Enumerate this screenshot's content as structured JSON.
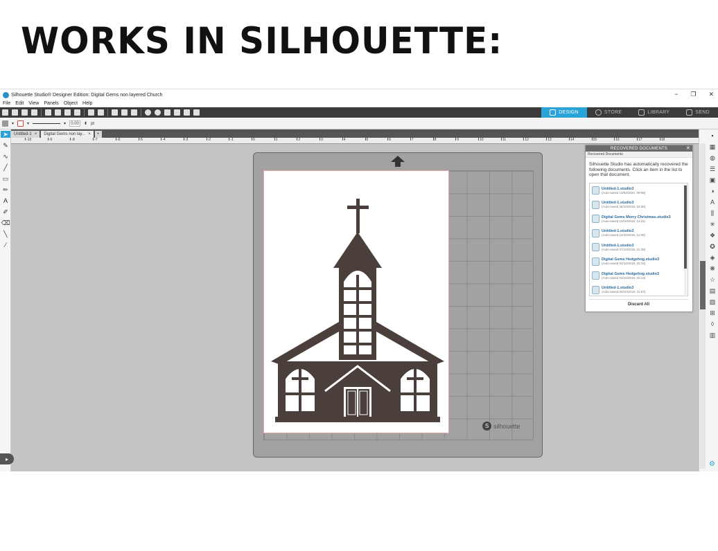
{
  "headline": "WORKS IN SILHOUETTE:",
  "window": {
    "title": "Silhouette Studio® Designer Edition: Digital Gems non layered Church",
    "controls": [
      "−",
      "❐",
      "✕"
    ]
  },
  "menu": [
    "File",
    "Edit",
    "View",
    "Panels",
    "Object",
    "Help"
  ],
  "nav_tabs": [
    {
      "label": "DESIGN",
      "active": true
    },
    {
      "label": "STORE",
      "active": false
    },
    {
      "label": "LIBRARY",
      "active": false
    },
    {
      "label": "SEND",
      "active": false
    }
  ],
  "options": {
    "line_value": "0.00",
    "unit": "pt"
  },
  "doc_tabs": [
    "Untitled-1",
    "Digital Gems non lay..."
  ],
  "ruler_numbers": [
    "-10",
    "-9",
    "-8",
    "-7",
    "-6",
    "-5",
    "-4",
    "-3",
    "-2",
    "-1",
    "0",
    "1",
    "2",
    "3",
    "4",
    "5",
    "6",
    "7",
    "8",
    "9",
    "10",
    "11",
    "12",
    "13",
    "14",
    "15",
    "16",
    "17",
    "18"
  ],
  "mat_brand": "silhouette",
  "recovered": {
    "title": "RECOVERED DOCUMENTS",
    "subtitle": "Recovered Documents",
    "message": "Silhouette Studio has automatically recovered the following documents. Click an item in the list to open that document.",
    "items": [
      {
        "name": "Untitled-1.studio3",
        "time": "(Auto-saved 13/02/2020, 09:06)"
      },
      {
        "name": "Untitled-1.studio3",
        "time": "(Auto-saved 26/10/2019, 16:30)"
      },
      {
        "name": "Digital Gems Merry Christmas.studio3",
        "time": "(Auto-saved 14/10/2019, 12:21)"
      },
      {
        "name": "Untitled-1.studio3",
        "time": "(Auto-saved 14/10/2019, 11:06)"
      },
      {
        "name": "Untitled-1.studio3",
        "time": "(Auto-saved 07/10/2019, 21:38)"
      },
      {
        "name": "Digital Gems Hedgehog.studio3",
        "time": "(Auto-saved 04/10/2019, 22:15)"
      },
      {
        "name": "Digital Gems Hedgehog.studio3",
        "time": "(Auto-saved 04/10/2019, 22:13)"
      },
      {
        "name": "Untitled-1.studio3",
        "time": "(Auto-saved 04/10/2019, 21:57)"
      }
    ],
    "discard_label": "Discard All"
  }
}
